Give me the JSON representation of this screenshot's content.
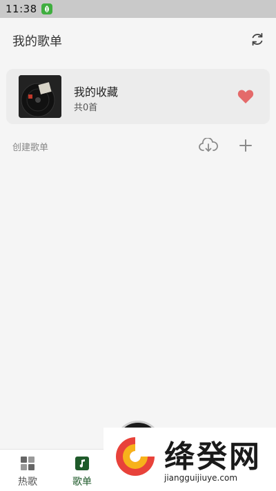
{
  "status_bar": {
    "time": "11:38",
    "app_icon": "leaf-app-icon"
  },
  "header": {
    "title": "我的歌单",
    "refresh_icon": "refresh-icon"
  },
  "favorites": {
    "title": "我的收藏",
    "count": "共0首",
    "heart_icon": "heart-icon",
    "heart_color": "#e46a6a"
  },
  "section": {
    "label": "创建歌单",
    "download_icon": "cloud-download-icon",
    "add_icon": "plus-icon"
  },
  "bottom_nav": {
    "items": [
      {
        "label": "热歌",
        "icon": "grid-icon",
        "active": false
      },
      {
        "label": "歌单",
        "icon": "music-note-icon",
        "active": true
      }
    ],
    "active_color": "#1e5a2a"
  },
  "watermark": {
    "brand": "绛癸网",
    "url": "jiangguijiuye.com"
  }
}
